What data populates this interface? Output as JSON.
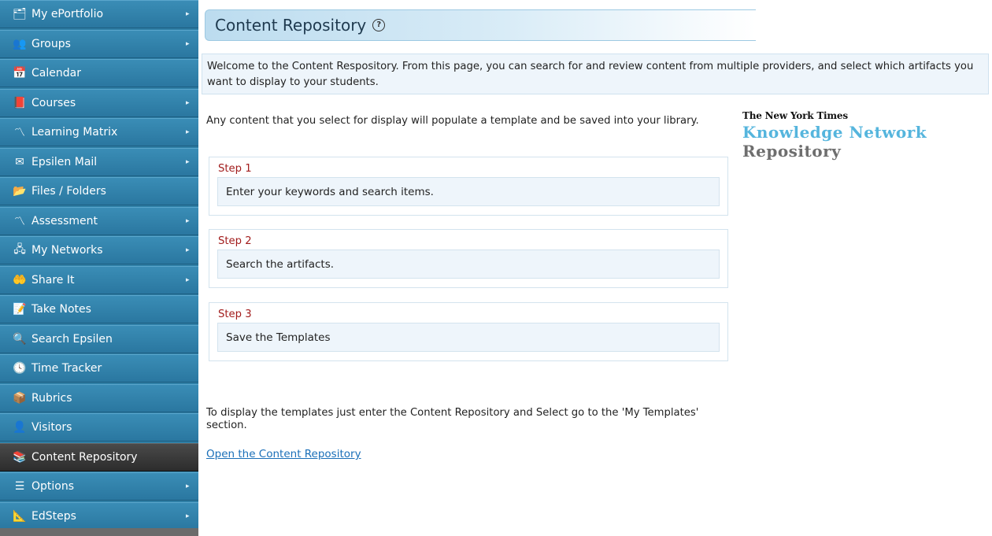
{
  "sidebar": {
    "items": [
      {
        "label": "My ePortfolio",
        "icon": "portfolio-icon",
        "glyph": "🗂",
        "arrow": true
      },
      {
        "label": "Groups",
        "icon": "groups-icon",
        "glyph": "👥",
        "arrow": true
      },
      {
        "label": "Calendar",
        "icon": "calendar-icon",
        "glyph": "📅",
        "arrow": false
      },
      {
        "label": "Courses",
        "icon": "courses-icon",
        "glyph": "📕",
        "arrow": true
      },
      {
        "label": "Learning Matrix",
        "icon": "learning-matrix-icon",
        "glyph": "〽",
        "arrow": true
      },
      {
        "label": "Epsilen Mail",
        "icon": "mail-icon",
        "glyph": "✉",
        "arrow": true
      },
      {
        "label": "Files / Folders",
        "icon": "folder-icon",
        "glyph": "📂",
        "arrow": false
      },
      {
        "label": "Assessment",
        "icon": "assessment-icon",
        "glyph": "〽",
        "arrow": true
      },
      {
        "label": "My Networks",
        "icon": "network-icon",
        "glyph": "🖧",
        "arrow": true
      },
      {
        "label": "Share It",
        "icon": "share-icon",
        "glyph": "🤲",
        "arrow": true
      },
      {
        "label": "Take Notes",
        "icon": "notes-icon",
        "glyph": "📝",
        "arrow": false
      },
      {
        "label": "Search Epsilen",
        "icon": "search-icon",
        "glyph": "🔍",
        "arrow": false
      },
      {
        "label": "Time Tracker",
        "icon": "clock-icon",
        "glyph": "🕓",
        "arrow": false
      },
      {
        "label": "Rubrics",
        "icon": "rubrics-icon",
        "glyph": "📦",
        "arrow": false
      },
      {
        "label": "Visitors",
        "icon": "visitors-icon",
        "glyph": "👤",
        "arrow": false
      },
      {
        "label": "Content Repository",
        "icon": "repository-icon",
        "glyph": "📚",
        "arrow": false,
        "active": true
      },
      {
        "label": "Options",
        "icon": "options-icon",
        "glyph": "☰",
        "arrow": true
      },
      {
        "label": "EdSteps",
        "icon": "edsteps-icon",
        "glyph": "📐",
        "arrow": true
      }
    ]
  },
  "header": {
    "title": "Content Repository",
    "help_glyph": "?"
  },
  "welcome_text": "Welcome to the Content Respository. From this page, you can search for and review content from multiple providers, and select which artifacts you want to display to your students.",
  "intro_text": "Any content that you select for display will populate a template and be saved into your library.",
  "steps": [
    {
      "title": "Step 1",
      "text": "Enter your keywords and search items."
    },
    {
      "title": "Step 2",
      "text": "Search the artifacts."
    },
    {
      "title": "Step 3",
      "text": "Save the Templates"
    }
  ],
  "footnote": "To display the templates just enter the Content Repository and Select go to the 'My Templates' section.",
  "open_link": "Open the Content Repository",
  "logo": {
    "line1": "The New York Times",
    "line2": "Knowledge Network",
    "line3": "Repository"
  },
  "colors": {
    "sidebar": "#2f7fa6",
    "active_item": "#333333",
    "step_title": "#a21d1d",
    "link": "#1a6fb8",
    "logo_blue": "#55b5dd"
  }
}
